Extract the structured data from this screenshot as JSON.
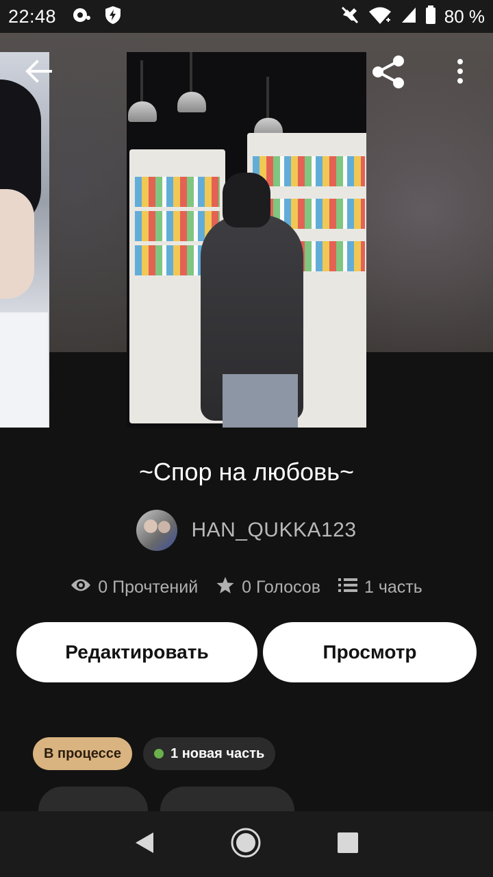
{
  "status_bar": {
    "time": "22:48",
    "battery_percent": "80 %",
    "left_icons": [
      "vpn-key-icon",
      "shield-bolt-icon"
    ],
    "right_icons": [
      "no-sound-icon",
      "wifi-icon",
      "signal-icon",
      "battery-icon"
    ]
  },
  "toolbar": {
    "back_icon": "arrow-left-icon",
    "share_icon": "share-icon",
    "menu_icon": "more-vertical-icon"
  },
  "story": {
    "title": "~Спор на любовь~",
    "author": "HAN_QUKKA123",
    "reads": "0 Прочтений",
    "votes": "0 Голосов",
    "parts": "1 часть"
  },
  "actions": {
    "edit_label": "Редактировать",
    "view_label": "Просмотр"
  },
  "tags": {
    "status": "В процессе",
    "new_part": "1 новая часть"
  },
  "colors": {
    "background": "#121212",
    "status_tag": "#d9b380",
    "new_dot": "#6ab04c",
    "button": "#ffffff"
  }
}
